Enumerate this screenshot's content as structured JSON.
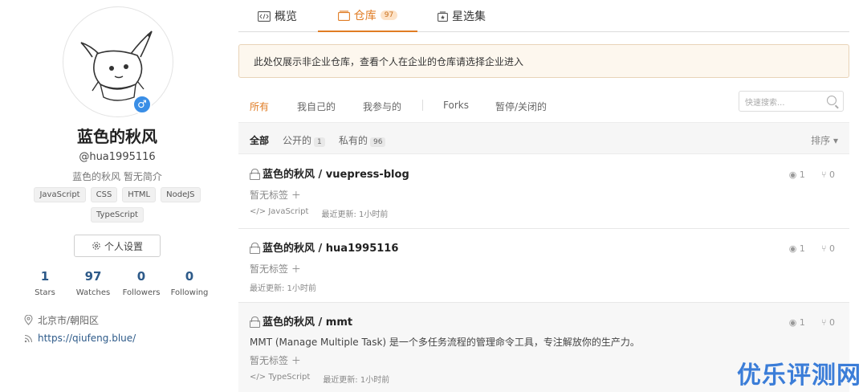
{
  "profile": {
    "name": "蓝色的秋风",
    "login": "@hua1995116",
    "bio": "蓝色的秋风 暂无简介",
    "gender_icon": "male-icon",
    "gender_symbol": "♂",
    "tags": [
      "JavaScript",
      "CSS",
      "HTML",
      "NodeJS",
      "TypeScript"
    ],
    "settings_label": "个人设置",
    "stats": [
      {
        "value": "1",
        "label": "Stars"
      },
      {
        "value": "97",
        "label": "Watches"
      },
      {
        "value": "0",
        "label": "Followers"
      },
      {
        "value": "0",
        "label": "Following"
      }
    ],
    "location": "北京市/朝阳区",
    "website": "https://qiufeng.blue/"
  },
  "tabs": [
    {
      "label": "概览",
      "icon": "code-icon"
    },
    {
      "label": "仓库",
      "icon": "repo-icon",
      "badge": "97",
      "active": true
    },
    {
      "label": "星选集",
      "icon": "collection-icon"
    }
  ],
  "notice": "此处仅展示非企业仓库，查看个人在企业的仓库请选择企业进入",
  "filters": [
    "所有",
    "我自己的",
    "我参与的",
    "Forks",
    "暂停/关闭的"
  ],
  "search_placeholder": "快速搜索...",
  "subfilters": {
    "all": "全部",
    "public": "公开的",
    "public_count": "1",
    "private": "私有的",
    "private_count": "96",
    "sort": "排序"
  },
  "repos": [
    {
      "title": "蓝色的秋风 / vuepress-blog",
      "tags": "暂无标签",
      "lang": "JavaScript",
      "updated": "最近更新: 1小时前",
      "watch": "1",
      "fork": "0"
    },
    {
      "title": "蓝色的秋风 / hua1995116",
      "tags": "暂无标签",
      "updated": "最近更新: 1小时前",
      "watch": "1",
      "fork": "0"
    },
    {
      "title": "蓝色的秋风 / mmt",
      "desc": "MMT (Manage Multiple Task) 是一个多任务流程的管理命令工具，专注解放你的生产力。",
      "tags": "暂无标签",
      "lang": "TypeScript",
      "updated": "最近更新: 1小时前",
      "watch": "1",
      "fork": "0"
    }
  ],
  "watermark": "优乐评测网",
  "colors": {
    "accent": "#e07c24",
    "link": "#2d5a89",
    "gender": "#3a8ee6"
  }
}
